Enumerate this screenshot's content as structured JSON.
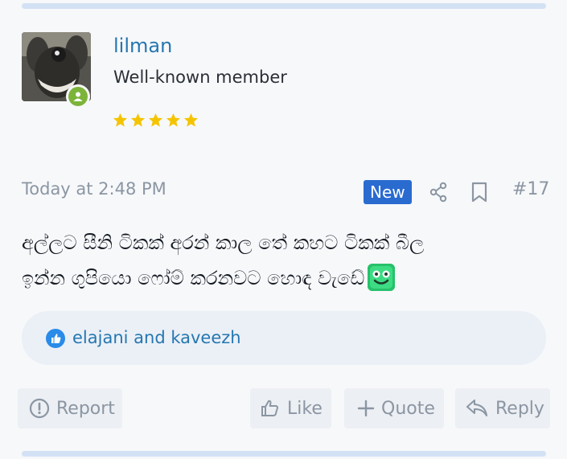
{
  "author": {
    "username": "lilman",
    "title": "Well-known member",
    "rating_stars": 5,
    "online": true
  },
  "post": {
    "date": "Today at 2:48 PM",
    "new_badge": "New",
    "number": "#17",
    "body_line1": "අල්ලට සීනි ටිකක් අරන් කාල තේ කහට ටිකක් බීල",
    "body_line2": "ඉන්න ගුපියො ෆෝම් කරනවට හොඳ වැඩේ"
  },
  "reactions": {
    "text": "elajani and kaveezh"
  },
  "actions": {
    "report": "Report",
    "like": "Like",
    "quote": "Quote",
    "reply": "Reply"
  },
  "colors": {
    "accent": "#2577b1",
    "badge": "#2a6bd0",
    "star": "#f5c400",
    "online": "#7cb43a"
  }
}
